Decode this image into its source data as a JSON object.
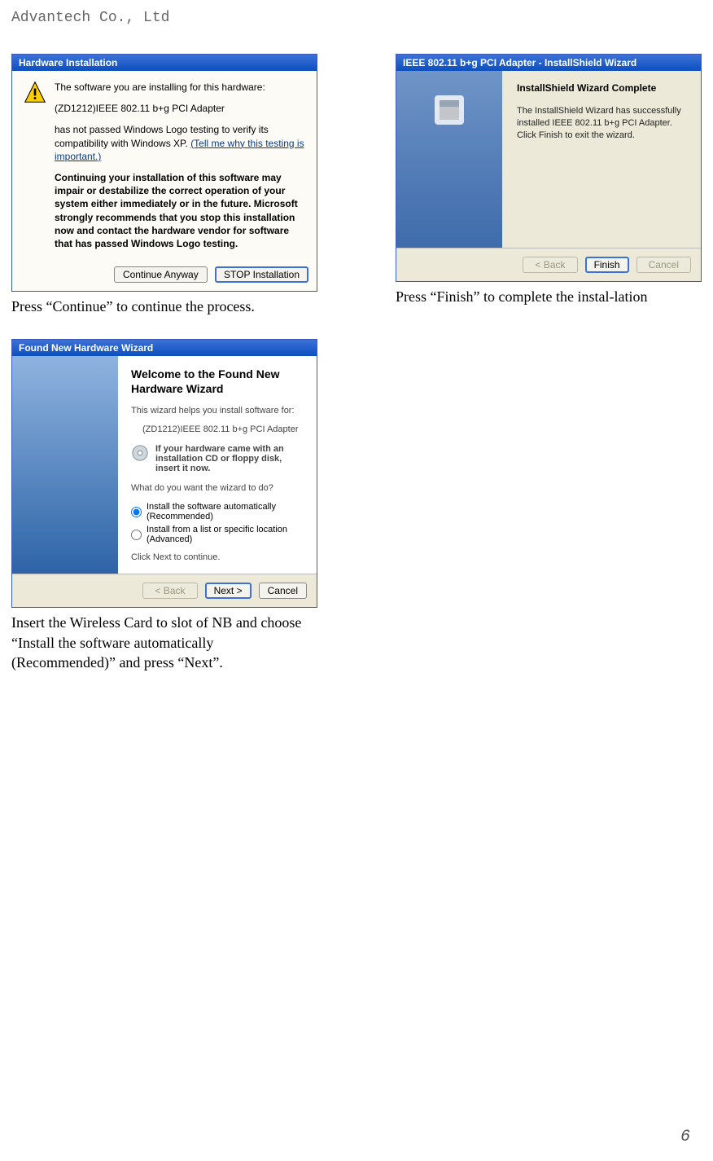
{
  "header": {
    "company": "Advantech Co., Ltd"
  },
  "page_number": "6",
  "hw_install": {
    "title": "Hardware Installation",
    "line1": "The software you are installing for this hardware:",
    "device": "(ZD1212)IEEE 802.11 b+g PCI Adapter",
    "line2_a": "has not passed Windows Logo testing to verify its compatibility with Windows XP. ",
    "line2_link": "(Tell me why this testing is important.)",
    "bold_block": "Continuing your installation of this software may impair or destabilize the correct operation of your system either immediately or in the future. Microsoft strongly recommends that you stop this installation now and contact the hardware vendor for software that has passed Windows Logo testing.",
    "btn_continue": "Continue Anyway",
    "btn_stop": "STOP Installation"
  },
  "caption_hw": "Press “Continue” to continue the process.",
  "ishield": {
    "title": "IEEE 802.11 b+g PCI Adapter - InstallShield Wizard",
    "heading": "InstallShield Wizard Complete",
    "body": "The InstallShield Wizard has successfully installed IEEE 802.11 b+g PCI Adapter. Click Finish to exit the wizard.",
    "btn_back": "< Back",
    "btn_finish": "Finish",
    "btn_cancel": "Cancel"
  },
  "caption_ishield": "Press “Finish” to complete the instal-lation",
  "fnhw": {
    "title": "Found New Hardware Wizard",
    "heading": "Welcome to the Found New Hardware Wizard",
    "intro": "This wizard helps you install software for:",
    "device": "(ZD1212)IEEE 802.11 b+g PCI Adapter",
    "cd_hint": "If your hardware came with an installation CD or floppy disk, insert it now.",
    "question": "What do you want the wizard to do?",
    "opt_auto": "Install the software automatically (Recommended)",
    "opt_list": "Install from a list or specific location (Advanced)",
    "foot": "Click Next to continue.",
    "btn_back": "< Back",
    "btn_next": "Next >",
    "btn_cancel": "Cancel"
  },
  "caption_fnhw": "Insert the Wireless Card to slot of NB and choose “Install the software automatically (Recommended)” and press “Next”."
}
